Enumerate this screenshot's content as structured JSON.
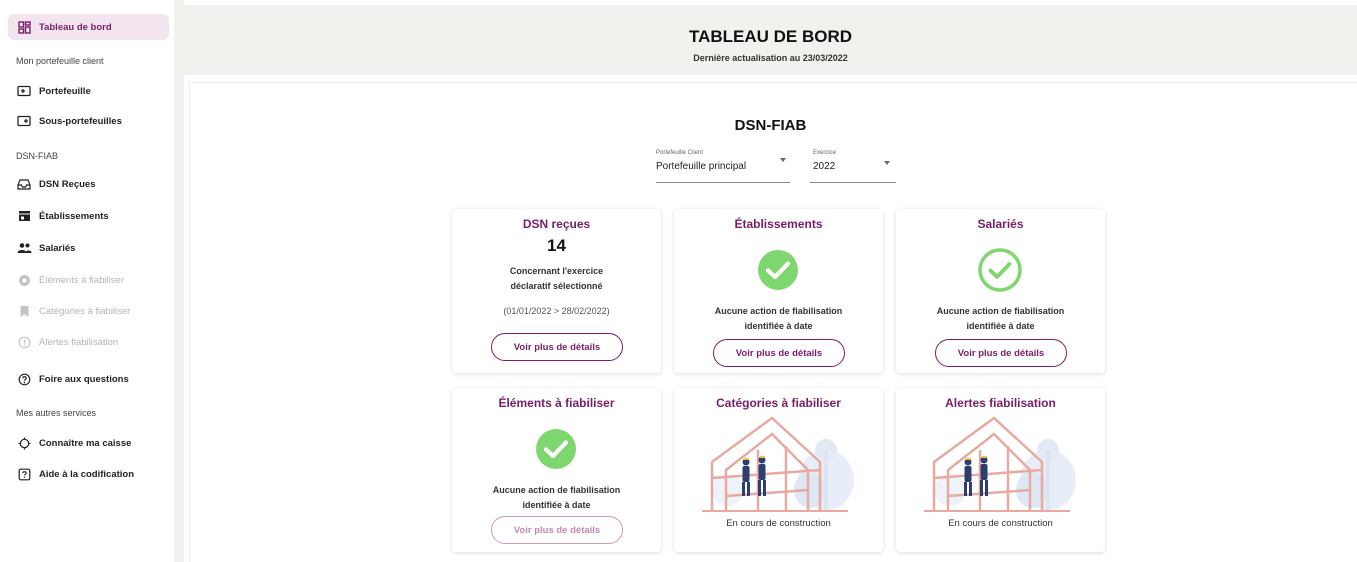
{
  "sidebar": {
    "items": [
      {
        "label": "Tableau de bord",
        "icon": "dashboard-icon"
      },
      {
        "label": "Portefeuille",
        "icon": "folder-icon"
      },
      {
        "label": "Sous-portefeuilles",
        "icon": "subfolder-icon"
      },
      {
        "label": "DSN Reçues",
        "icon": "inbox-icon"
      },
      {
        "label": "Établissements",
        "icon": "store-icon"
      },
      {
        "label": "Salariés",
        "icon": "people-icon"
      },
      {
        "label": "Éléments à fiabiliser",
        "icon": "settings-circle-icon"
      },
      {
        "label": "Catégories à fiabiliser",
        "icon": "bookmark-icon"
      },
      {
        "label": "Alertes fiabilisation",
        "icon": "alert-circle-icon"
      },
      {
        "label": "Foire aux questions",
        "icon": "help-circle-icon"
      },
      {
        "label": "Connaître ma caisse",
        "icon": "location-icon"
      },
      {
        "label": "Aide à la codification",
        "icon": "help-box-icon"
      }
    ],
    "sections": [
      "Mon portefeuille client",
      "DSN-FIAB",
      "Mes autres services"
    ]
  },
  "header": {
    "title": "TABLEAU DE BORD",
    "subtitle": "Dernière actualisation au 23/03/2022"
  },
  "main": {
    "section_title": "DSN-FIAB",
    "filters": {
      "portfolio": {
        "label": "Portefeuille Client",
        "value": "Portefeuille principal"
      },
      "exercise": {
        "label": "Exercice",
        "value": "2022"
      }
    },
    "cards": [
      {
        "title": "DSN reçues",
        "count": "14",
        "desc_line1": "Concernant l'exercice",
        "desc_line2": "déclaratif sélectionné",
        "period": "(01/01/2022 > 28/02/2022)",
        "button": "Voir plus de détails"
      },
      {
        "title": "Établissements",
        "desc_line1": "Aucune action de fiabilisation",
        "desc_line2": "identifiée à date",
        "button": "Voir plus de détails"
      },
      {
        "title": "Salariés",
        "desc_line1": "Aucune action de fiabilisation",
        "desc_line2": "identifiée à date",
        "button": "Voir plus de détails"
      },
      {
        "title": "Éléments à fiabiliser",
        "desc_line1": "Aucune action de fiabilisation",
        "desc_line2": "identifiée à date",
        "button": "Voir plus de détails"
      },
      {
        "title": "Catégories à fiabiliser",
        "status": "En cours de construction"
      },
      {
        "title": "Alertes fiabilisation",
        "status": "En cours de construction"
      }
    ]
  },
  "colors": {
    "accent": "#7a1e67",
    "success": "#7ed66e",
    "active_bg": "#f3e5ef",
    "header_bg": "#f2f1ee"
  }
}
